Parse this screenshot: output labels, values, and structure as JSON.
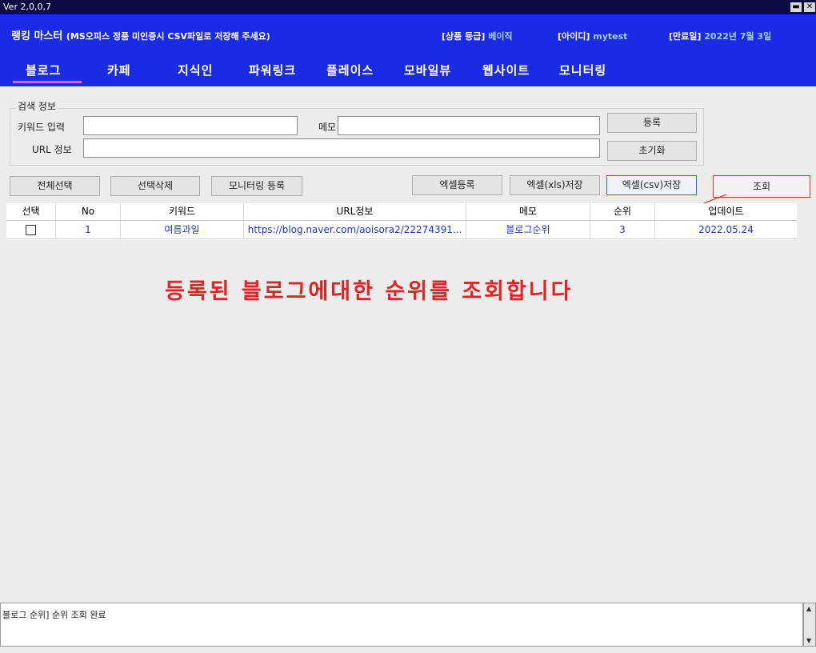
{
  "window": {
    "version": "Ver 2,0,0,7",
    "minimize_glyph": "▬",
    "close_glyph": "✕"
  },
  "header": {
    "app_name": "랭킹 마스터",
    "notice": "(MS오피스 정품 미인증시 CSV파일로 저장해 주세요)",
    "grade_label": "[상품 등급]",
    "grade_value": "베이직",
    "id_label": "[아이디]",
    "id_value": "mytest",
    "expiry_label": "[만료일]",
    "expiry_value": "2022년 7월 3일"
  },
  "tabs": [
    {
      "label": "블로그",
      "active": true
    },
    {
      "label": "카페"
    },
    {
      "label": "지식인"
    },
    {
      "label": "파워링크"
    },
    {
      "label": "플레이스"
    },
    {
      "label": "모바일뷰"
    },
    {
      "label": "웹사이트"
    },
    {
      "label": "모니터링"
    }
  ],
  "search": {
    "group_label": "검색 정보",
    "keyword_label": "키워드 입력",
    "keyword_value": "",
    "memo_label": "메모",
    "memo_value": "",
    "url_label": "URL 정보",
    "url_value": "",
    "register_button": "등록",
    "reset_button": "초기화"
  },
  "toolbar": {
    "select_all": "전체선택",
    "delete_selected": "선택삭제",
    "register_monitoring": "모니터링 등록",
    "excel_register": "엑셀등록",
    "excel_xls_save": "엑셀(xls)저장",
    "excel_csv_save": "엑셀(csv)저장",
    "lookup": "조회"
  },
  "table": {
    "columns": [
      "선택",
      "No",
      "키워드",
      "URL정보",
      "메모",
      "순위",
      "업데이트"
    ],
    "rows": [
      {
        "checked": false,
        "no": "1",
        "keyword": "여름과일",
        "url": "https://blog.naver.com/aoisora2/22274391...",
        "memo": "블로그순위",
        "rank": "3",
        "updated": "2022.05.24"
      }
    ]
  },
  "annotation": {
    "text": "등록된 블로그에대한 순위를 조회합니다",
    "color": "#e02424"
  },
  "log": {
    "text": "블로그 순위] 순위 조회 완료"
  },
  "colors": {
    "header_bg": "#1a2be6",
    "tab_underline": "#ff5fb0",
    "cell_text": "#1e35c8"
  }
}
